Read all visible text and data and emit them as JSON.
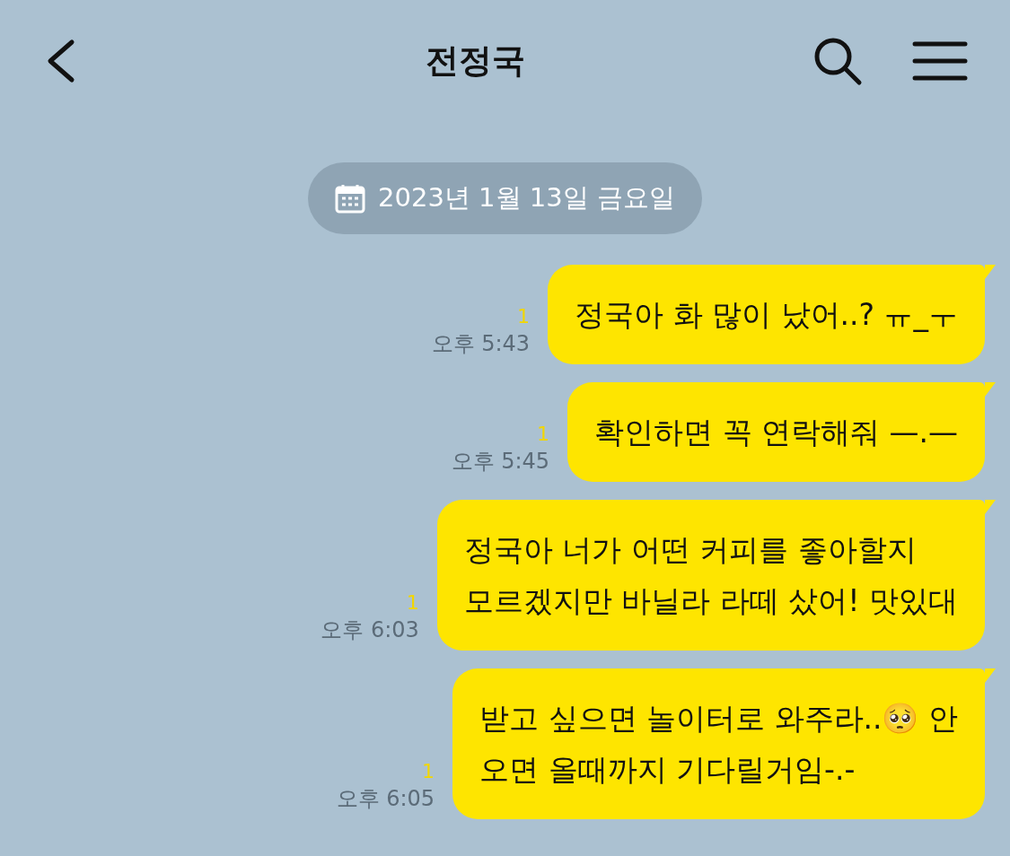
{
  "header": {
    "title": "전정국"
  },
  "date_divider": {
    "text": "2023년 1월 13일 금요일"
  },
  "messages": [
    {
      "text": "정국아 화 많이 났어..? ㅠ_ㅜ",
      "unread": "1",
      "time": "오후 5:43"
    },
    {
      "text": "확인하면 꼭 연락해줘 —.—",
      "unread": "1",
      "time": "오후 5:45"
    },
    {
      "text": "정국아 너가 어떤 커피를 좋아할지\n모르겠지만 바닐라 라떼 샀어! 맛있대",
      "unread": "1",
      "time": "오후 6:03"
    },
    {
      "text": "받고 싶으면 놀이터로 와주라..🥺 안\n오면 올때까지 기다릴거임-.-",
      "unread": "1",
      "time": "오후 6:05"
    }
  ]
}
